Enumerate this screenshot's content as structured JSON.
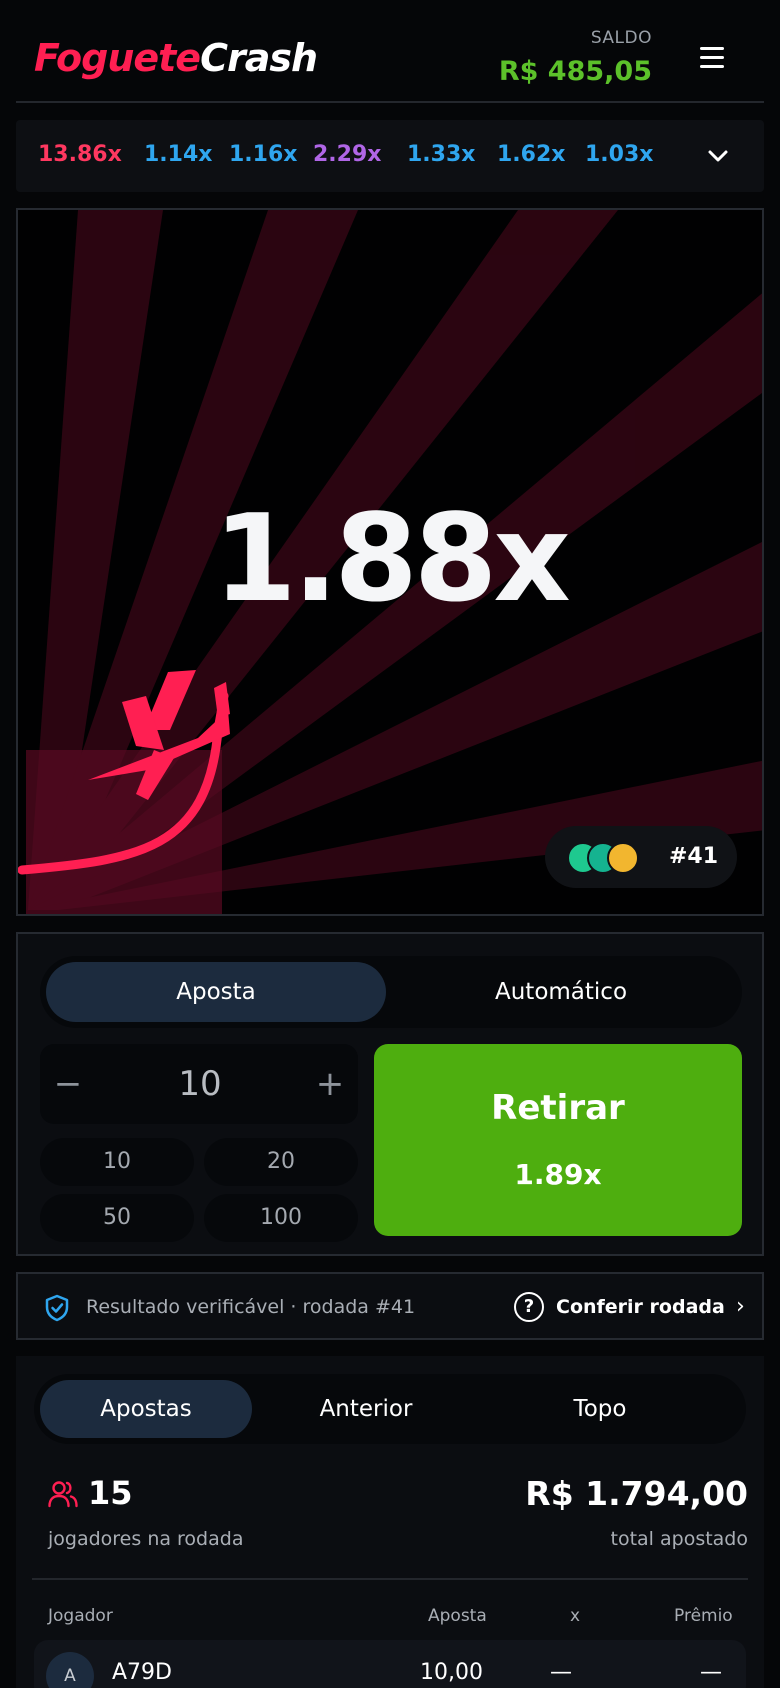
{
  "header": {
    "logo_part1": "Foguete",
    "logo_part2": "Crash",
    "saldo_label": "SALDO",
    "saldo_value": "R$ 485,05",
    "menu_icon": "hamburger-menu-icon"
  },
  "history": {
    "items": [
      {
        "label": "13.86x",
        "color": "#ff3860"
      },
      {
        "label": "1.14x",
        "color": "#2fa6ef"
      },
      {
        "label": "1.16x",
        "color": "#2fa6ef"
      },
      {
        "label": "2.29x",
        "color": "#b066e6"
      },
      {
        "label": "1.33x",
        "color": "#2fa6ef"
      },
      {
        "label": "1.62x",
        "color": "#2fa6ef"
      },
      {
        "label": "1.03x",
        "color": "#2fa6ef"
      }
    ],
    "expand_icon": "chevron-down-icon"
  },
  "game": {
    "multiplier": "1.88x",
    "round": "#41",
    "accent": "#ff1f52",
    "player_dots": [
      "#1ec98f",
      "#15b390",
      "#f2b62f"
    ]
  },
  "bet": {
    "tabs": [
      "Aposta",
      "Automático"
    ],
    "active_tab": "Aposta",
    "amount": "10",
    "minus": "−",
    "plus": "+",
    "quick_amounts": [
      "10",
      "20",
      "50",
      "100"
    ],
    "cashout_label": "Retirar",
    "cashout_multiplier": "1.89x",
    "cashout_color": "#4eae0f"
  },
  "verify": {
    "text": "Resultado verificável · rodada #41",
    "link": "Conferir rodada",
    "link_chevron": "›",
    "question": "?"
  },
  "bets_list": {
    "tabs": [
      "Apostas",
      "Anterior",
      "Topo"
    ],
    "active_tab": "Apostas",
    "players_count": "15",
    "players_label": "jogadores na rodada",
    "total_amount": "R$ 1.794,00",
    "total_label": "total apostado",
    "columns": [
      "Jogador",
      "Aposta",
      "x",
      "Prêmio"
    ],
    "rows": [
      {
        "avatar": "A",
        "name": "A79D",
        "bet": "10,00",
        "mult": "—",
        "prize": "—"
      }
    ]
  }
}
